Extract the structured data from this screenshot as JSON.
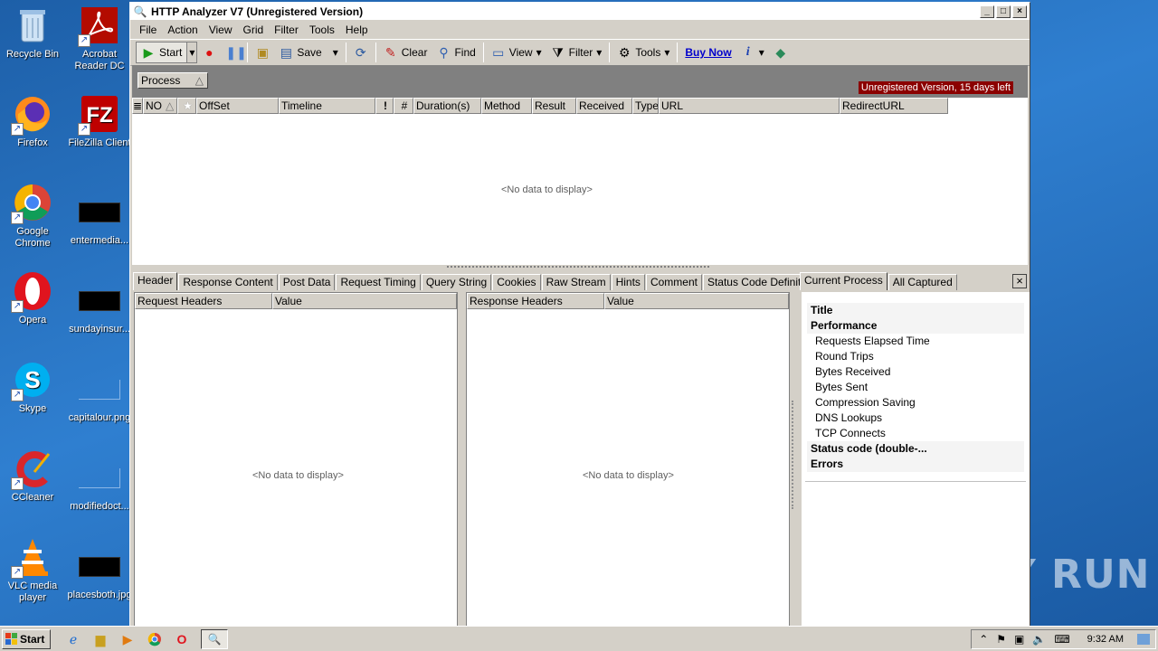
{
  "desktop": {
    "icons": [
      {
        "label": "Recycle Bin"
      },
      {
        "label": "Acrobat Reader DC"
      },
      {
        "label": "Firefox"
      },
      {
        "label": "FileZilla Client"
      },
      {
        "label": "Google Chrome"
      },
      {
        "label": "entermedia..."
      },
      {
        "label": "Opera"
      },
      {
        "label": "sundayinsur..."
      },
      {
        "label": "Skype"
      },
      {
        "label": "capitalour.png"
      },
      {
        "label": "CCleaner"
      },
      {
        "label": "modifiedoct..."
      },
      {
        "label": "VLC media player"
      },
      {
        "label": "placesboth.jpg"
      }
    ]
  },
  "window": {
    "title": "HTTP Analyzer V7  (Unregistered Version)",
    "menu": [
      "File",
      "Action",
      "View",
      "Grid",
      "Filter",
      "Tools",
      "Help"
    ],
    "toolbar": {
      "start": "Start",
      "save": "Save",
      "clear": "Clear",
      "find": "Find",
      "view": "View",
      "filter": "Filter",
      "tools": "Tools",
      "buy_now": "Buy Now"
    },
    "group_chip": "Process",
    "unregistered_notice": "Unregistered Version, 15 days left",
    "grid_columns": [
      "NO",
      "OffSet",
      "Timeline",
      "!",
      "#",
      "Duration(s)",
      "Method",
      "Result",
      "Received",
      "Type",
      "URL",
      "RedirectURL"
    ],
    "no_data": "<No data to display>",
    "tabs": [
      "Header",
      "Response Content",
      "Post Data",
      "Request Timing",
      "Query String",
      "Cookies",
      "Raw Stream",
      "Hints",
      "Comment",
      "Status Code Definition"
    ],
    "request_headers": {
      "col1": "Request Headers",
      "col2": "Value"
    },
    "response_headers": {
      "col1": "Response Headers",
      "col2": "Value"
    },
    "right_tabs": [
      "Current Process",
      "All Captured"
    ],
    "tree": [
      {
        "label": "Title",
        "kind": "bold"
      },
      {
        "label": "Performance",
        "kind": "bold"
      },
      {
        "label": "Requests Elapsed Time",
        "kind": "child"
      },
      {
        "label": "Round Trips",
        "kind": "child"
      },
      {
        "label": "Bytes Received",
        "kind": "child"
      },
      {
        "label": "Bytes Sent",
        "kind": "child"
      },
      {
        "label": "Compression Saving",
        "kind": "child"
      },
      {
        "label": "DNS Lookups",
        "kind": "child"
      },
      {
        "label": "TCP Connects",
        "kind": "child"
      },
      {
        "label": "Status code (double-...",
        "kind": "bold"
      },
      {
        "label": "Errors",
        "kind": "bold"
      }
    ]
  },
  "watermark": "ANY RUN",
  "taskbar": {
    "start": "Start",
    "clock": "9:32 AM"
  },
  "colors": {
    "unregistered_bg": "#8b0000",
    "buy_now": "#0000cc",
    "desktop_bg": "#2f7fd0"
  }
}
